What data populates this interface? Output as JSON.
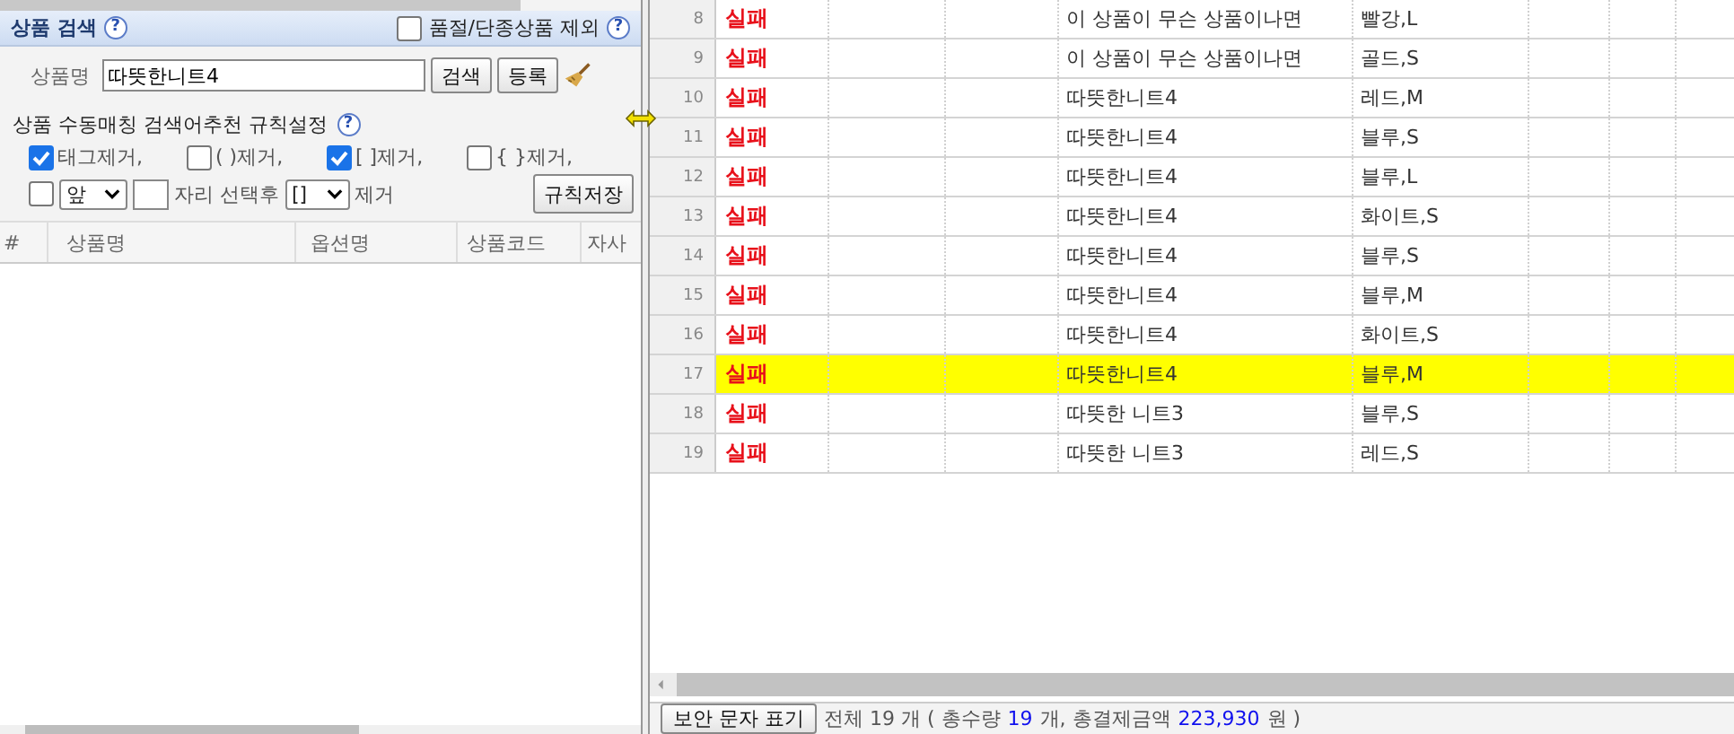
{
  "search_panel": {
    "title": "상품 검색",
    "help": "?",
    "exclude_soldout": {
      "label": "품절/단종상품 제외",
      "checked": false
    },
    "exclude_help": "?",
    "name_label": "상품명",
    "name_value": "따뜻한니트4",
    "buttons": [
      "검색",
      "등록"
    ],
    "rules": {
      "title": "상품 수동매칭 검색어추천 규칙설정",
      "help": "?",
      "options": [
        {
          "label": "태그제거,",
          "checked": true
        },
        {
          "label": "( )제거,",
          "checked": false
        },
        {
          "label": "[ ]제거,",
          "checked": true
        },
        {
          "label": "{ }제거,",
          "checked": false
        }
      ],
      "position_checked": false,
      "position_select": "앞",
      "after_label": "자리 선택후",
      "bracket_select": "[]",
      "remove_label": "제거",
      "save_button": "규칙저장"
    },
    "columns": [
      "#",
      "상품명",
      "옵션명",
      "상품코드",
      "자사"
    ]
  },
  "grid": {
    "rows": [
      {
        "number": "8",
        "result": "실패",
        "product": "이 상품이 무슨 상품이나면",
        "option": "빨강,L",
        "selected": false
      },
      {
        "number": "9",
        "result": "실패",
        "product": "이 상품이 무슨 상품이나면",
        "option": "골드,S",
        "selected": false
      },
      {
        "number": "10",
        "result": "실패",
        "product": "따뜻한니트4",
        "option": "레드,M",
        "selected": false
      },
      {
        "number": "11",
        "result": "실패",
        "product": "따뜻한니트4",
        "option": "블루,S",
        "selected": false
      },
      {
        "number": "12",
        "result": "실패",
        "product": "따뜻한니트4",
        "option": "블루,L",
        "selected": false
      },
      {
        "number": "13",
        "result": "실패",
        "product": "따뜻한니트4",
        "option": "화이트,S",
        "selected": false
      },
      {
        "number": "14",
        "result": "실패",
        "product": "따뜻한니트4",
        "option": "블루,S",
        "selected": false
      },
      {
        "number": "15",
        "result": "실패",
        "product": "따뜻한니트4",
        "option": "블루,M",
        "selected": false
      },
      {
        "number": "16",
        "result": "실패",
        "product": "따뜻한니트4",
        "option": "화이트,S",
        "selected": false
      },
      {
        "number": "17",
        "result": "실패",
        "product": "따뜻한니트4",
        "option": "블루,M",
        "selected": true
      },
      {
        "number": "18",
        "result": "실패",
        "product": "따뜻한 니트3",
        "option": "블루,S",
        "selected": false
      },
      {
        "number": "19",
        "result": "실패",
        "product": "따뜻한 니트3",
        "option": "레드,S",
        "selected": false
      }
    ]
  },
  "status_bar": {
    "button": "보안 문자 표기",
    "segments": [
      {
        "text": "전체 19 개 ( 총수량",
        "highlight": false
      },
      {
        "text": "19",
        "highlight": true
      },
      {
        "text": "개, 총결제금액",
        "highlight": false
      },
      {
        "text": "223,930",
        "highlight": true
      },
      {
        "text": "원 )",
        "highlight": false
      }
    ]
  }
}
